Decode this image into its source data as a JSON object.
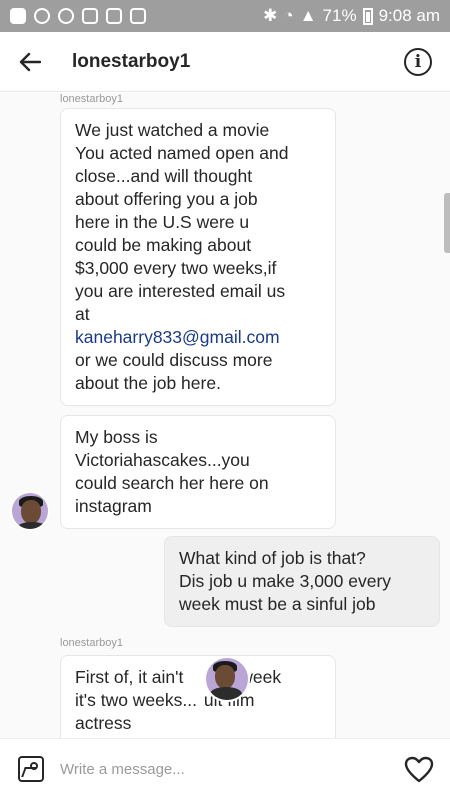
{
  "status_bar": {
    "battery": "71%",
    "time": "9:08 am"
  },
  "header": {
    "title": "lonestarboy1"
  },
  "messages": {
    "sender_1": "lonestarboy1",
    "m1_lines": [
      "We just watched a movie",
      "You acted named open and",
      "close...and will thought",
      "about offering you a job",
      "here in the U.S were u",
      "could be making about",
      "$3,000 every two weeks,if",
      "you are interested email us",
      "at"
    ],
    "m1_email": "kaneharry833@gmail.com",
    "m1_tail": [
      "or we could discuss more",
      "about the job here."
    ],
    "m2_lines": [
      "My boss is",
      "Victoriahascakes...you",
      "could search her here on",
      "instagram"
    ],
    "m3_lines": [
      "What kind of job is that?",
      "Dis job u make 3,000 every",
      "week must be a sinful job"
    ],
    "sender_2": "lonestarboy1",
    "m4_lines": [
      "First of, it ain't",
      "week",
      "it's two weeks...",
      "ult film",
      "actress"
    ]
  },
  "input": {
    "placeholder": "Write a message..."
  },
  "icons": [
    "back-arrow-icon",
    "info-icon",
    "gallery-icon",
    "heart-icon"
  ],
  "colors": {
    "status_bar": "#9e9e9e",
    "link": "#1a3a8a",
    "outgoing_bubble": "#efefef"
  }
}
